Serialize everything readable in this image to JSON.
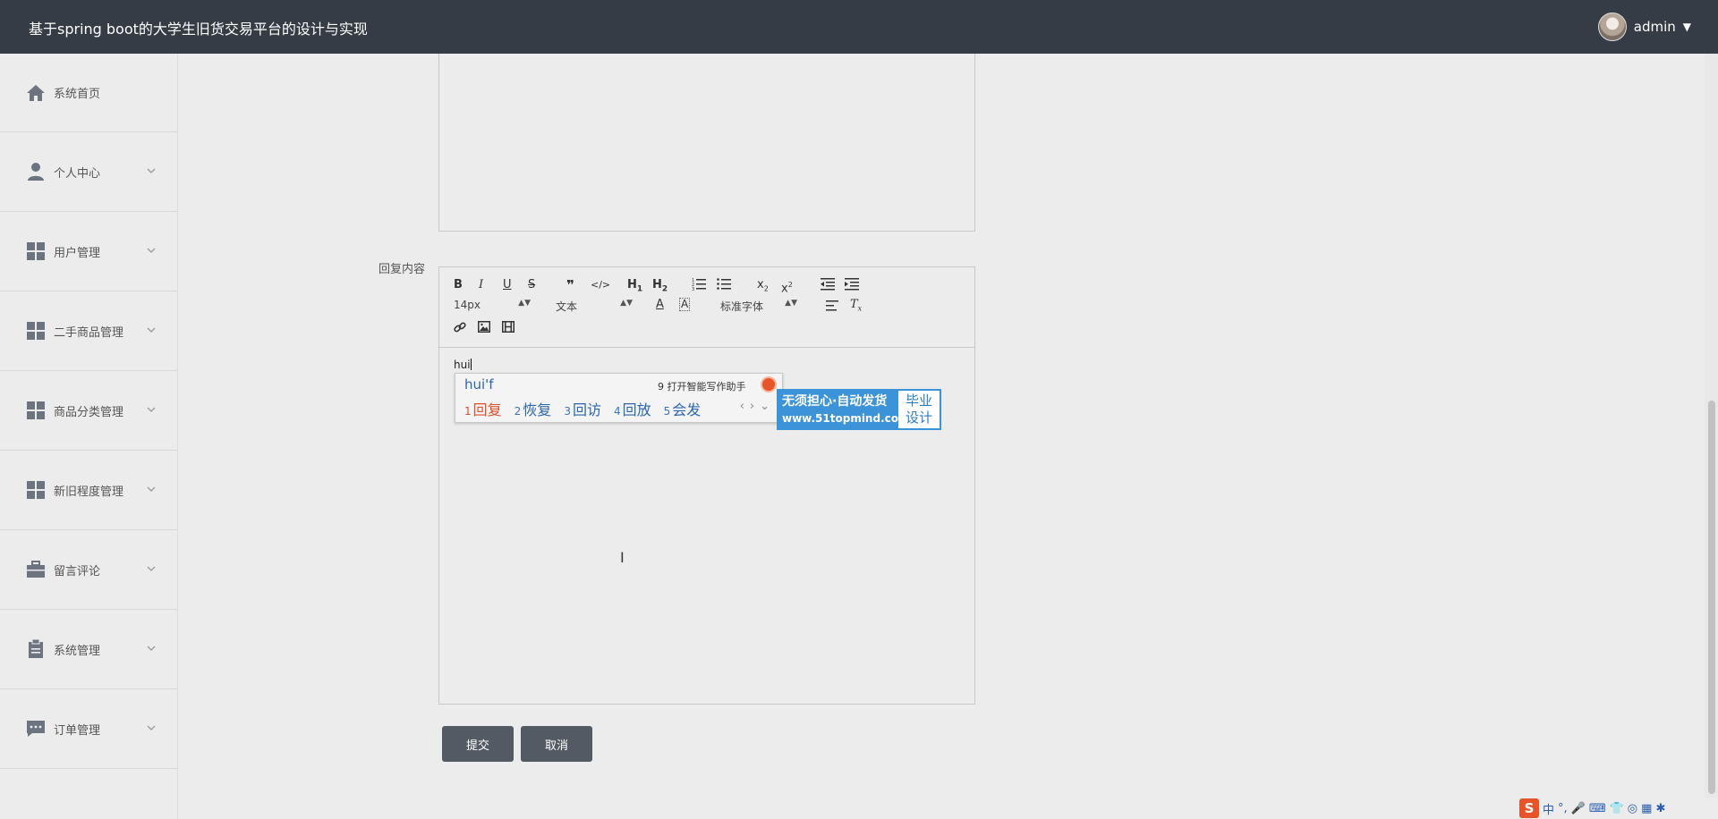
{
  "header": {
    "title": "基于spring boot的大学生旧货交易平台的设计与实现",
    "username": "admin"
  },
  "sidebar": {
    "items": [
      {
        "label": "系统首页",
        "icon": "home-icon"
      },
      {
        "label": "个人中心",
        "icon": "user-icon"
      },
      {
        "label": "用户管理",
        "icon": "grid-icon"
      },
      {
        "label": "二手商品管理",
        "icon": "grid-icon"
      },
      {
        "label": "商品分类管理",
        "icon": "grid-icon"
      },
      {
        "label": "新旧程度管理",
        "icon": "grid-icon"
      },
      {
        "label": "留言评论",
        "icon": "briefcase-icon"
      },
      {
        "label": "系统管理",
        "icon": "clipboard-icon"
      },
      {
        "label": "订单管理",
        "icon": "chat-icon"
      }
    ]
  },
  "form": {
    "reply_label": "回复内容",
    "submit_label": "提交",
    "cancel_label": "取消"
  },
  "editor": {
    "font_size": "14px",
    "text_type": "文本",
    "font_family": "标准字体",
    "content": "hui"
  },
  "ime": {
    "composition": "hui'f",
    "hint": "9 打开智能写作助手",
    "candidates": [
      {
        "n": "1",
        "text": "回复"
      },
      {
        "n": "2",
        "text": "恢复"
      },
      {
        "n": "3",
        "text": "回访"
      },
      {
        "n": "4",
        "text": "回放"
      },
      {
        "n": "5",
        "text": "会发"
      }
    ]
  },
  "ad": {
    "line1": "无须担心·自动发货",
    "url": "www.51topmind.com",
    "right_line1": "毕业",
    "right_line2": "设计"
  },
  "tray": {
    "logo": "S",
    "lang": "中"
  },
  "colors": {
    "header_bg": "#363c46",
    "button_bg": "#545a63",
    "ime_accent": "#d8502d",
    "ad_blue": "#3d93d8"
  }
}
